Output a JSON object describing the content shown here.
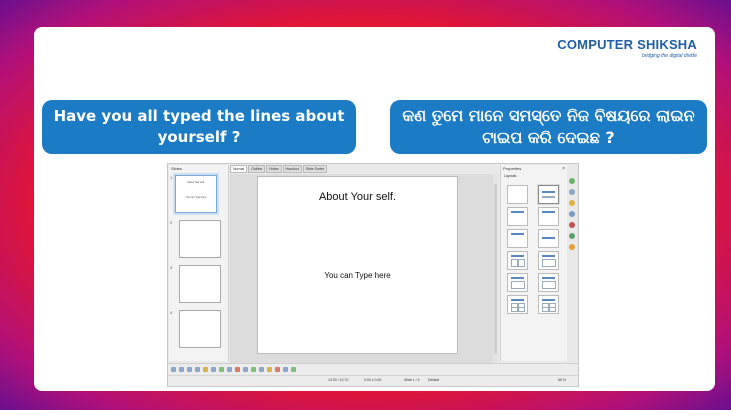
{
  "brand": {
    "name": "COMPUTER SHIKSHA",
    "tagline": "bridging the digital divide"
  },
  "question_english": "Have you all typed the lines about yourself ?",
  "question_odia": "କଣ ତୁମେ ମାନେ ସମସ୍ତେ ନିଜ ବିଷୟରେ ଲାଇନ ଟାଇପ କରି ଦେଇଛ ?",
  "app": {
    "slides_pane_title": "Slides",
    "tabs": [
      "Normal",
      "Outline",
      "Notes",
      "Handout",
      "Slide Sorter"
    ],
    "thumbnails": [
      {
        "num": "1",
        "title": "About Your self.",
        "body": "You can Type here"
      },
      {
        "num": "2"
      },
      {
        "num": "3"
      },
      {
        "num": "4"
      }
    ],
    "slide": {
      "title": "About Your self.",
      "body": "You can Type here"
    },
    "properties": {
      "title": "Properties",
      "section": "Layouts"
    },
    "status": {
      "position": "13.00 / 10.70",
      "size": "0.00 x 0.00",
      "slide": "Slide 1 / 4",
      "master": "Default",
      "zoom": "65 %"
    }
  },
  "colors": {
    "bubble": "#1b7bc4",
    "brand": "#1f5ea8"
  }
}
